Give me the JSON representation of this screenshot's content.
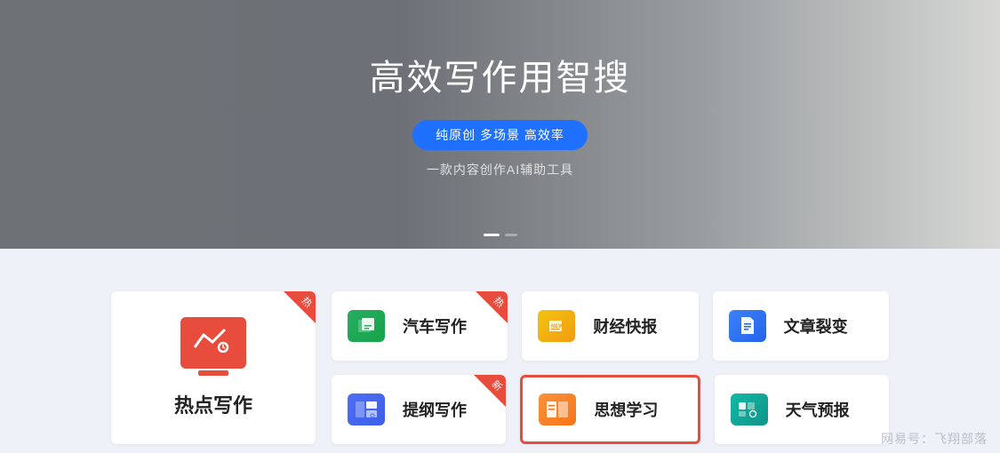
{
  "hero": {
    "title": "高效写作用智搜",
    "pill_text": "纯原创 多场景 高效率",
    "subtitle": "一款内容创作AI辅助工具"
  },
  "cards": {
    "big": {
      "label": "热点写作",
      "tag": "热"
    },
    "row1": [
      {
        "label": "汽车写作",
        "tag": "热",
        "iconClass": "ic-green"
      },
      {
        "label": "财经快报",
        "tag": null,
        "iconClass": "ic-yellow"
      },
      {
        "label": "文章裂变",
        "tag": null,
        "iconClass": "ic-bluefile"
      }
    ],
    "row2": [
      {
        "label": "提纲写作",
        "tag": "新",
        "iconClass": "ic-bluegrid",
        "highlight": false
      },
      {
        "label": "思想学习",
        "tag": null,
        "iconClass": "ic-orange",
        "highlight": true
      },
      {
        "label": "天气预报",
        "tag": null,
        "iconClass": "ic-teal",
        "highlight": false
      }
    ]
  },
  "watermark": "网易号：飞翔部落",
  "colors": {
    "accent": "#2070ff",
    "hot": "#e74c3c"
  }
}
